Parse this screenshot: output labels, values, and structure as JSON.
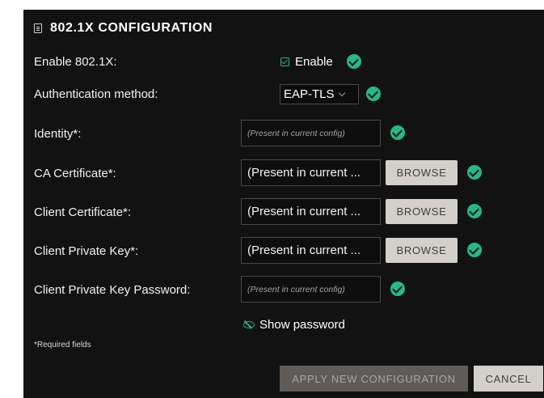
{
  "panel": {
    "title": "802.1X CONFIGURATION",
    "title_icon": "document-icon",
    "accent_color": "#26b88a",
    "background_color": "#121212"
  },
  "enable": {
    "label": "Enable 802.1X:",
    "checkbox_label": "Enable",
    "checked": true
  },
  "auth": {
    "label": "Authentication method:",
    "selected": "EAP-TLS"
  },
  "fields": {
    "identity": {
      "label": "Identity*:",
      "placeholder": "(Present in current config)"
    },
    "ca_cert": {
      "label": "CA Certificate*:",
      "value": "(Present in current ...",
      "button": "BROWSE"
    },
    "client_cert": {
      "label": "Client Certificate*:",
      "value": "(Present in current ...",
      "button": "BROWSE"
    },
    "client_key": {
      "label": "Client Private Key*:",
      "value": "(Present in current ...",
      "button": "BROWSE"
    },
    "key_password": {
      "label": "Client Private Key Password:",
      "placeholder": "(Present in current config)"
    }
  },
  "show_password": {
    "label": "Show password",
    "icon": "eye-slash-icon"
  },
  "required_note": "*Required fields",
  "actions": {
    "apply": "APPLY NEW CONFIGURATION",
    "cancel": "CANCEL"
  }
}
